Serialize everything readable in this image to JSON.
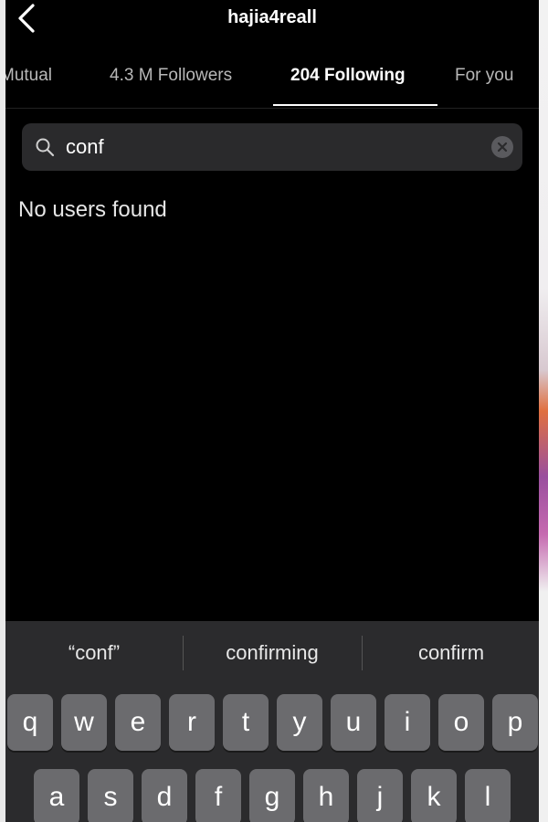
{
  "header": {
    "title": "hajia4reall"
  },
  "tabs": [
    {
      "label": "Mutual"
    },
    {
      "label": "4.3 M Followers"
    },
    {
      "label": "204 Following"
    },
    {
      "label": "For you"
    }
  ],
  "search": {
    "value": "conf"
  },
  "results": {
    "empty_message": "No users found"
  },
  "keyboard": {
    "suggestions": [
      "“conf”",
      "confirming",
      "confirm"
    ],
    "row1": [
      "q",
      "w",
      "e",
      "r",
      "t",
      "y",
      "u",
      "i",
      "o",
      "p"
    ],
    "row2": [
      "a",
      "s",
      "d",
      "f",
      "g",
      "h",
      "j",
      "k",
      "l"
    ]
  }
}
